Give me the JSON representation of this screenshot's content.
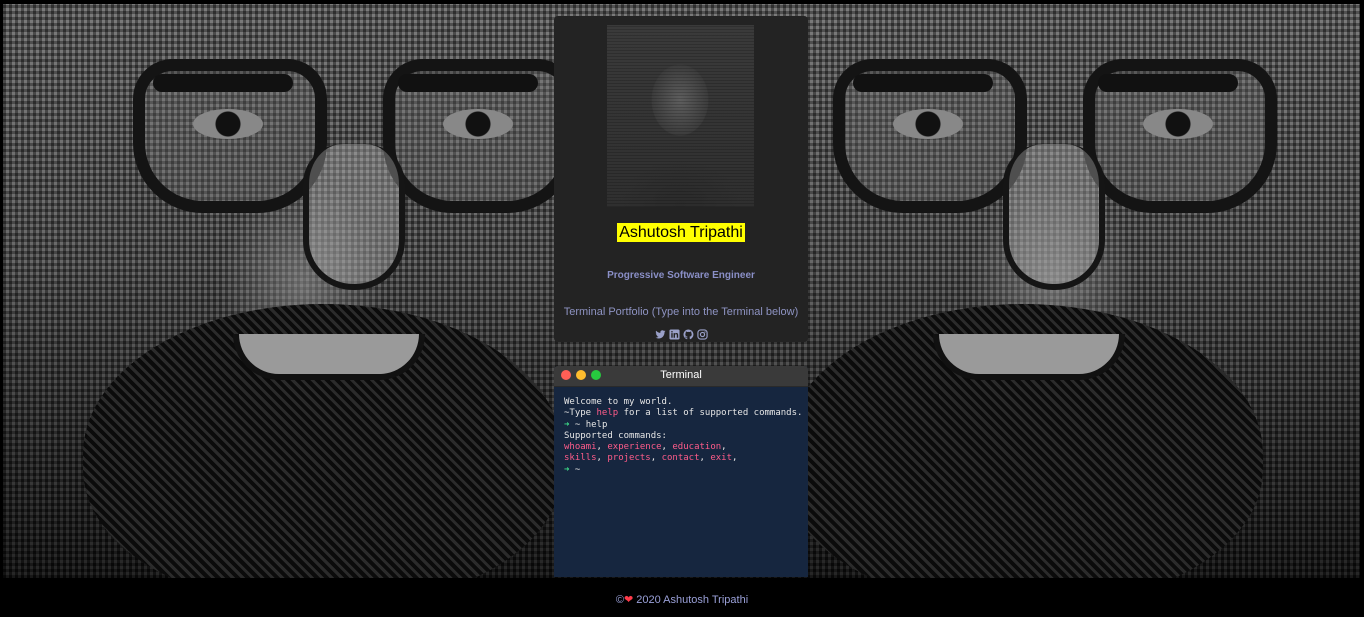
{
  "profile": {
    "name": "Ashutosh Tripathi",
    "role": "Progressive Software Engineer",
    "tagline": "Terminal Portfolio (Type into the Terminal below)",
    "social_icons": [
      "twitter-icon",
      "linkedin-icon",
      "github-icon",
      "instagram-icon"
    ]
  },
  "terminal": {
    "title": "Terminal",
    "welcome": "Welcome to my world.",
    "hint_prefix": "~Type ",
    "hint_keyword": "help",
    "hint_suffix": " for a list of supported commands.",
    "prompt_symbol": "➜",
    "prompt_path": " ~ ",
    "entered_command": "help",
    "supported_label": "Supported commands:",
    "commands_row1": [
      "whoami",
      "experience",
      "education"
    ],
    "commands_row2": [
      "skills",
      "projects",
      "contact",
      "exit"
    ]
  },
  "footer": {
    "copyright_symbol": "©",
    "text": " 2020 Ashutosh Tripathi"
  },
  "colors": {
    "name_highlight": "#ffff00",
    "terminal_bg": "#16263f",
    "command_color": "#ff5c8a",
    "prompt_color": "#3ee08a"
  }
}
